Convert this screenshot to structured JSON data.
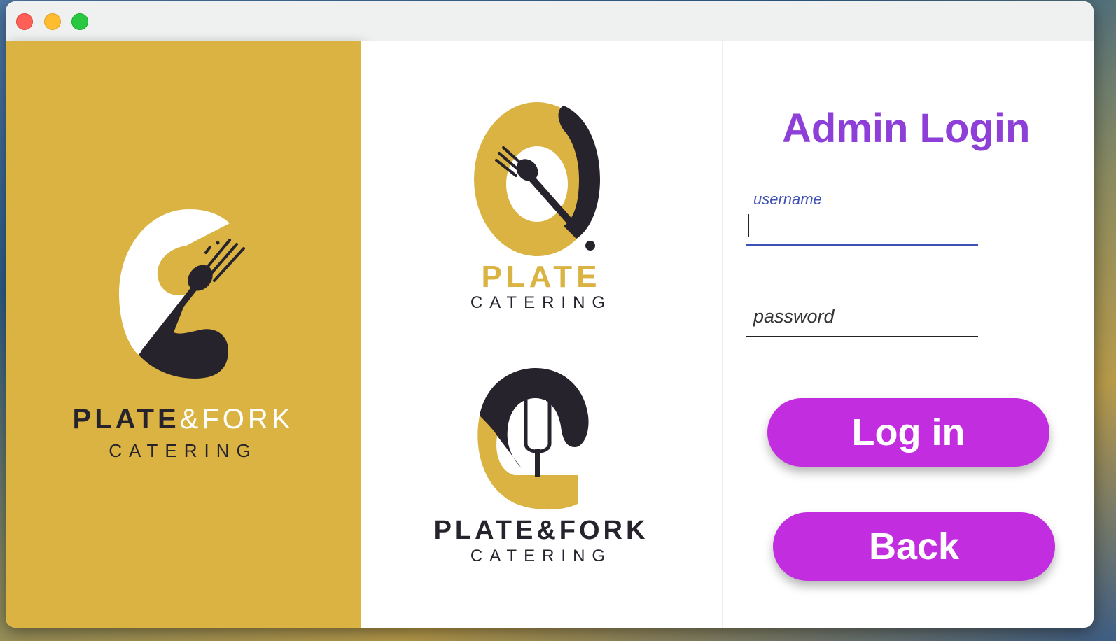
{
  "window": {
    "traffic_lights": [
      "close",
      "minimize",
      "maximize"
    ]
  },
  "left_panel": {
    "logo_name_bold": "PLATE",
    "logo_name_light": "&FORK",
    "logo_tagline": "CATERING",
    "background_color": "#dab342"
  },
  "middle_panel": {
    "logo1_name": "PLATE",
    "logo1_tagline": "CATERING",
    "logo2_name": "PLATE&FORK",
    "logo2_tagline": "CATERING"
  },
  "login": {
    "title": "Admin Login",
    "username_label": "username",
    "username_value": "",
    "password_label": "password",
    "password_value": "",
    "login_button": "Log in",
    "back_button": "Back"
  },
  "colors": {
    "accent": "#c22edf",
    "title": "#8d3fd8",
    "gold": "#dab342",
    "dark": "#26232d",
    "focus_underline": "#3f51b5"
  },
  "icons": [
    "plate-fork-logo-icon",
    "plate-logo-icon",
    "plate-fork-logo-alt-icon"
  ]
}
